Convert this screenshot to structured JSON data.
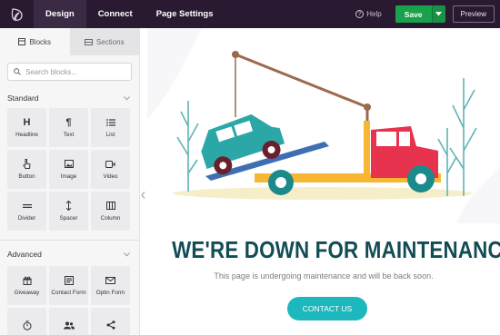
{
  "topbar": {
    "logo_icon": "seedprod-leaf-icon",
    "nav": [
      {
        "label": "Design",
        "active": true
      },
      {
        "label": "Connect",
        "active": false
      },
      {
        "label": "Page Settings",
        "active": false
      }
    ],
    "help_label": "Help",
    "save_label": "Save",
    "preview_label": "Preview"
  },
  "sidebar": {
    "tabs": [
      {
        "label": "Blocks",
        "active": true,
        "icon": "blocks-icon"
      },
      {
        "label": "Sections",
        "active": false,
        "icon": "sections-icon"
      }
    ],
    "search_placeholder": "Search blocks...",
    "standard": {
      "title": "Standard",
      "blocks": [
        {
          "label": "Headline",
          "icon": "headline-icon"
        },
        {
          "label": "Text",
          "icon": "paragraph-icon"
        },
        {
          "label": "List",
          "icon": "list-icon"
        },
        {
          "label": "Button",
          "icon": "pointer-icon"
        },
        {
          "label": "Image",
          "icon": "image-icon"
        },
        {
          "label": "Video",
          "icon": "video-icon"
        },
        {
          "label": "Divider",
          "icon": "divider-icon"
        },
        {
          "label": "Spacer",
          "icon": "spacer-icon"
        },
        {
          "label": "Column",
          "icon": "column-icon"
        }
      ]
    },
    "advanced": {
      "title": "Advanced",
      "blocks": [
        {
          "label": "Giveaway",
          "icon": "giveaway-icon"
        },
        {
          "label": "Contact Form",
          "icon": "contact-form-icon"
        },
        {
          "label": "Optin Form",
          "icon": "envelope-icon"
        },
        {
          "label": "",
          "icon": "stopwatch-icon"
        },
        {
          "label": "",
          "icon": "users-icon"
        },
        {
          "label": "",
          "icon": "share-icon"
        }
      ]
    }
  },
  "canvas": {
    "headline": "WE'RE DOWN FOR MAINTENANCE",
    "subtext": "This page is undergoing maintenance and will be back soon.",
    "cta_label": "CONTACT US"
  },
  "colors": {
    "topbar": "#2a1a31",
    "save": "#1aa14b",
    "headline": "#124c54",
    "cta": "#1cb8be",
    "truck_red": "#e8334f",
    "car_teal": "#2aa7a6"
  }
}
